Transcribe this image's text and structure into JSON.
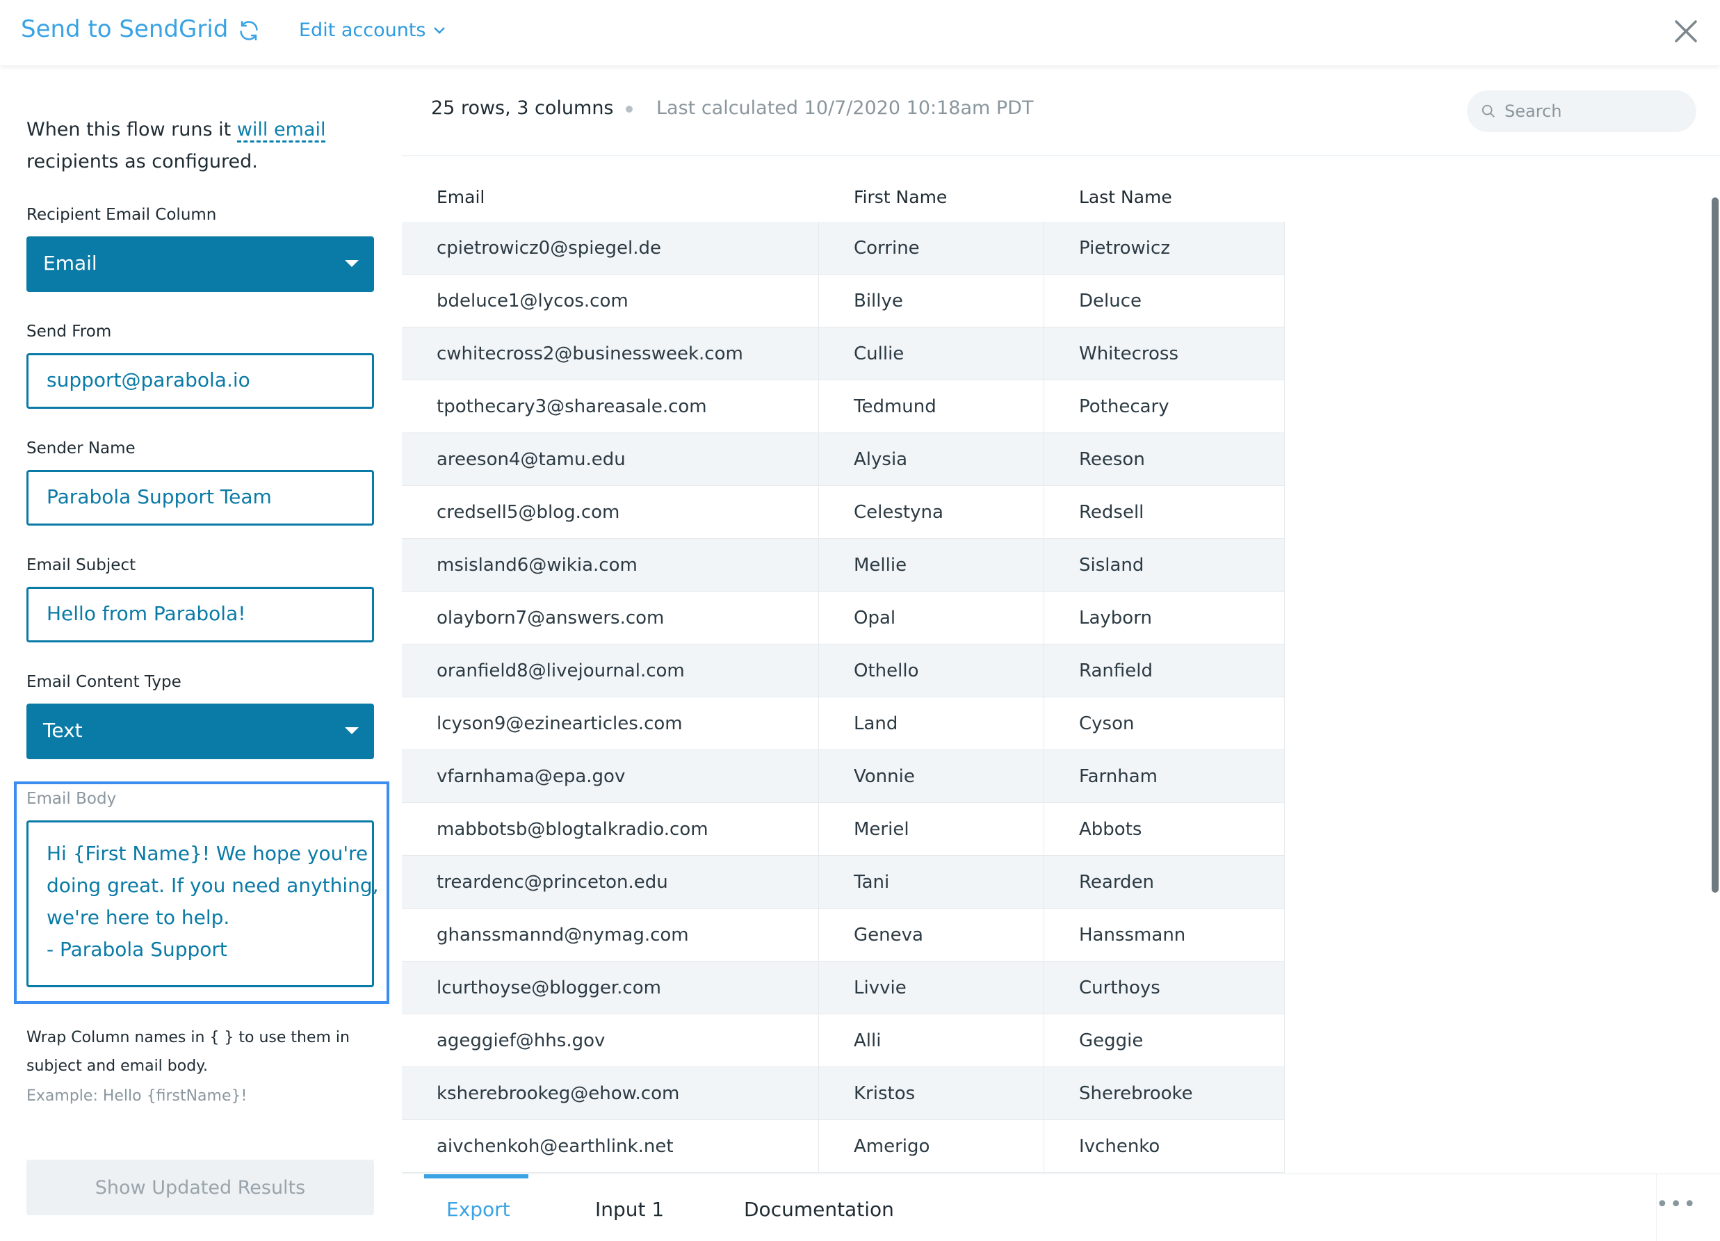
{
  "header": {
    "title": "Send to SendGrid",
    "edit_accounts": "Edit accounts",
    "icons": [
      "refresh-icon",
      "chevron-down-icon",
      "close-icon"
    ]
  },
  "left_panel": {
    "intro_before": "When this flow runs it ",
    "intro_link": "will email",
    "intro_after": " recipients as configured.",
    "recipient_label": "Recipient Email Column",
    "recipient_value": "Email",
    "send_from_label": "Send From",
    "send_from_value": "support@parabola.io",
    "sender_name_label": "Sender Name",
    "sender_name_value": "Parabola Support Team",
    "subject_label": "Email Subject",
    "subject_value": "Hello from Parabola!",
    "content_type_label": "Email Content Type",
    "content_type_value": "Text",
    "body_label": "Email Body",
    "body_lines": [
      "Hi {First Name}! We hope you're",
      "doing great. If you need anything,",
      "we're here to help.",
      "- Parabola Support"
    ],
    "hint": "Wrap Column names in { } to use them in subject and email body.",
    "example": "Example: Hello {firstName}!",
    "show_button": "Show Updated Results"
  },
  "right_panel": {
    "rows_cols": "25 rows, 3 columns",
    "last_calculated": "Last calculated 10/7/2020 10:18am PDT",
    "search_placeholder": "Search",
    "columns": [
      "Email",
      "First Name",
      "Last Name"
    ],
    "rows": [
      [
        "cpietrowicz0@spiegel.de",
        "Corrine",
        "Pietrowicz"
      ],
      [
        "bdeluce1@lycos.com",
        "Billye",
        "Deluce"
      ],
      [
        "cwhitecross2@businessweek.com",
        "Cullie",
        "Whitecross"
      ],
      [
        "tpothecary3@shareasale.com",
        "Tedmund",
        "Pothecary"
      ],
      [
        "areeson4@tamu.edu",
        "Alysia",
        "Reeson"
      ],
      [
        "credsell5@blog.com",
        "Celestyna",
        "Redsell"
      ],
      [
        "msisland6@wikia.com",
        "Mellie",
        "Sisland"
      ],
      [
        "olayborn7@answers.com",
        "Opal",
        "Layborn"
      ],
      [
        "oranfield8@livejournal.com",
        "Othello",
        "Ranfield"
      ],
      [
        "lcyson9@ezinearticles.com",
        "Land",
        "Cyson"
      ],
      [
        "vfarnhama@epa.gov",
        "Vonnie",
        "Farnham"
      ],
      [
        "mabbotsb@blogtalkradio.com",
        "Meriel",
        "Abbots"
      ],
      [
        "treardenc@princeton.edu",
        "Tani",
        "Rearden"
      ],
      [
        "ghanssmannd@nymag.com",
        "Geneva",
        "Hanssmann"
      ],
      [
        "lcurthoyse@blogger.com",
        "Livvie",
        "Curthoys"
      ],
      [
        "ageggief@hhs.gov",
        "Alli",
        "Geggie"
      ],
      [
        "ksherebrookeg@ehow.com",
        "Kristos",
        "Sherebrooke"
      ],
      [
        "aivchenkoh@earthlink.net",
        "Amerigo",
        "Ivchenko"
      ]
    ],
    "tabs": [
      "Export",
      "Input 1",
      "Documentation"
    ],
    "more": "•••"
  },
  "colors": {
    "accent": "#3aa3e3",
    "select_bg": "#0a7aa6",
    "focus_ring": "#3b8df0"
  }
}
